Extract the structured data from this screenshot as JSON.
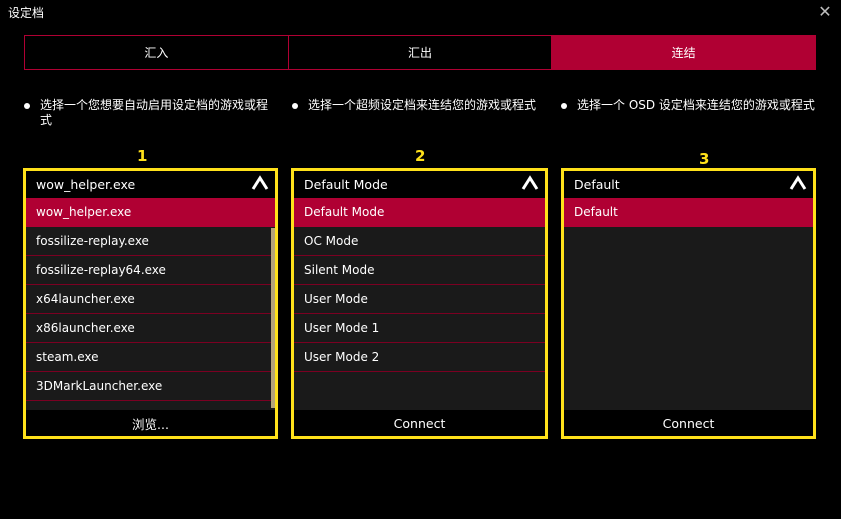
{
  "window": {
    "title": "设定档",
    "close_glyph": "✕"
  },
  "tabs": [
    {
      "label": "汇入",
      "active": false
    },
    {
      "label": "汇出",
      "active": false
    },
    {
      "label": "连结",
      "active": true
    }
  ],
  "descriptions": [
    "选择一个您想要自动启用设定档的游戏或程式",
    "选择一个超频设定档来连结您的游戏或程式",
    "选择一个 OSD 设定档来连结您的游戏或程式"
  ],
  "columns": [
    {
      "number": "1",
      "header": "wow_helper.exe",
      "items": [
        "wow_helper.exe",
        "fossilize-replay.exe",
        "fossilize-replay64.exe",
        "x64launcher.exe",
        "x86launcher.exe",
        "steam.exe",
        "3DMarkLauncher.exe"
      ],
      "footer": "浏览..."
    },
    {
      "number": "2",
      "header": "Default Mode",
      "items": [
        "Default Mode",
        "OC Mode",
        "Silent Mode",
        "User Mode",
        "User Mode 1",
        "User Mode 2"
      ],
      "footer": "Connect"
    },
    {
      "number": "3",
      "header": "Default",
      "items": [
        "Default"
      ],
      "footer": "Connect"
    }
  ],
  "colors": {
    "accent": "#b00033",
    "highlight": "#ffe11a",
    "list_bg": "#1a1a1a"
  }
}
